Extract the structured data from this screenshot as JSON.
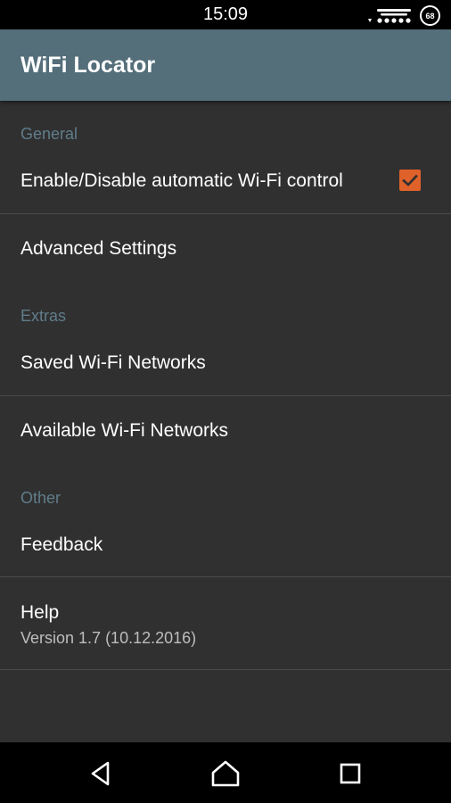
{
  "status_bar": {
    "time": "15:09",
    "battery_level": "68",
    "icons": [
      "signal-icon",
      "battery-icon"
    ]
  },
  "app_bar": {
    "title": "WiFi Locator"
  },
  "colors": {
    "app_bar": "#546e7a",
    "background": "#303030",
    "section_header": "#607d8b",
    "checkbox_accent": "#e0622a"
  },
  "sections": {
    "general": {
      "header": "General",
      "automatic_control": {
        "title": "Enable/Disable automatic Wi-Fi control",
        "checked": true
      },
      "advanced": {
        "title": "Advanced Settings"
      }
    },
    "extras": {
      "header": "Extras",
      "saved_networks": {
        "title": "Saved Wi-Fi Networks"
      },
      "available_networks": {
        "title": "Available Wi-Fi Networks"
      }
    },
    "other": {
      "header": "Other",
      "feedback": {
        "title": "Feedback"
      },
      "help": {
        "title": "Help",
        "summary": "Version 1.7 (10.12.2016)"
      }
    }
  },
  "nav_bar": {
    "buttons": [
      "back-icon",
      "home-icon",
      "recents-icon"
    ]
  }
}
